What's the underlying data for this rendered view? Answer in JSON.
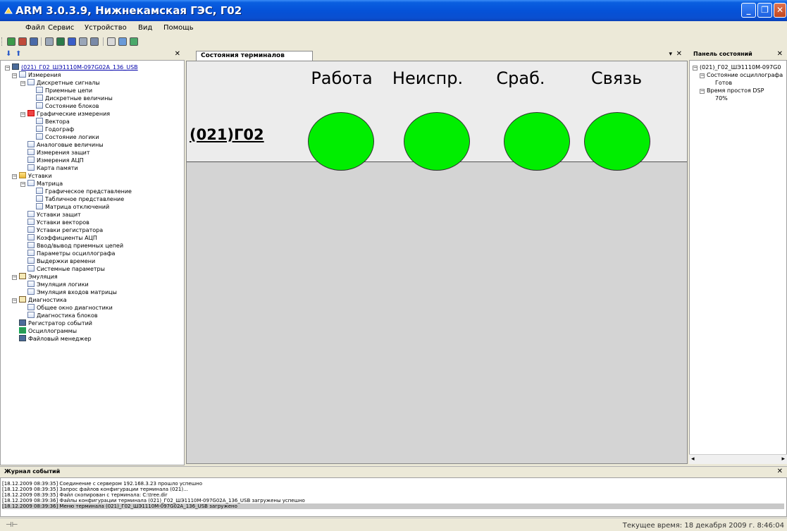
{
  "window": {
    "title": "ARM 3.0.3.9, Нижнекамская ГЭС, Г02",
    "minimize": "_",
    "maximize": "❐",
    "close": "✕"
  },
  "menu": [
    "Файл",
    "Сервис",
    "Устройство",
    "Вид",
    "Помощь"
  ],
  "tree": {
    "root": "(021)_Г02_ШЭ1110М-097G02A_136_USB",
    "items": [
      {
        "label": "Измерения"
      },
      {
        "label": "Дискретные сигналы"
      },
      {
        "label": "Приемные цепи"
      },
      {
        "label": "Дискретные величины"
      },
      {
        "label": "Состояние блоков"
      },
      {
        "label": "Графические измерения"
      },
      {
        "label": "Вектора"
      },
      {
        "label": "Годограф"
      },
      {
        "label": "Состояние логики"
      },
      {
        "label": "Аналоговые величины"
      },
      {
        "label": "Измерения защит"
      },
      {
        "label": "Измерения АЦП"
      },
      {
        "label": "Карта памяти"
      },
      {
        "label": "Уставки"
      },
      {
        "label": "Матрица"
      },
      {
        "label": "Графическое представление"
      },
      {
        "label": "Табличное представление"
      },
      {
        "label": "Матрица отключений"
      },
      {
        "label": "Уставки защит"
      },
      {
        "label": "Уставки векторов"
      },
      {
        "label": "Уставки регистратора"
      },
      {
        "label": "Коэффициенты АЦП"
      },
      {
        "label": "Ввод/вывод приемных цепей"
      },
      {
        "label": "Параметры осциллографа"
      },
      {
        "label": "Выдержки времени"
      },
      {
        "label": "Системные параметры"
      },
      {
        "label": "Эмуляция"
      },
      {
        "label": "Эмуляция логики"
      },
      {
        "label": "Эмуляция входов матрицы"
      },
      {
        "label": "Диагностика"
      },
      {
        "label": "Общее окно диагностики"
      },
      {
        "label": "Диагностика блоков"
      },
      {
        "label": "Регистратор событий"
      },
      {
        "label": "Осциллограммы"
      },
      {
        "label": "Файловый менеджер"
      }
    ]
  },
  "document": {
    "tab": "Состояния терминалов",
    "terminal": "(021)Г02",
    "columns": [
      "Работа",
      "Неиспр.",
      "Сраб.",
      "Связь"
    ],
    "lamp_color": "#00ee00"
  },
  "status_panel": {
    "title": "Панель состояний",
    "root": "(021)_Г02_ШЭ1110М-097G0",
    "oscillograph": "Состояние осциллографа",
    "oscillograph_value": "Готов",
    "dsp": "Время простоя DSP",
    "dsp_value": "70%"
  },
  "log": {
    "title": "Журнал событий",
    "rows": [
      "[18.12.2009 08:39:35] Соединение с сервером 192.168.3.23 прошло успешно",
      "[18.12.2009 08:39:35] Запрос файлов конфигурации терминала (021)...",
      "[18.12.2009 08:39:35] Файл скопирован с терминала: C:\\tree.dir",
      "[18.12.2009 08:39:36] Файлы конфигурации терминала (021)_Г02_ШЭ1110М-097G02A_136_USB загружены успешно",
      "[18.12.2009 08:39:36] Меню терминала (021)_Г02_ШЭ1110М-097G02A_136_USB загружено"
    ]
  },
  "statusbar": {
    "time": "Текущее время: 18 декабря 2009 г. 8:46:04"
  }
}
